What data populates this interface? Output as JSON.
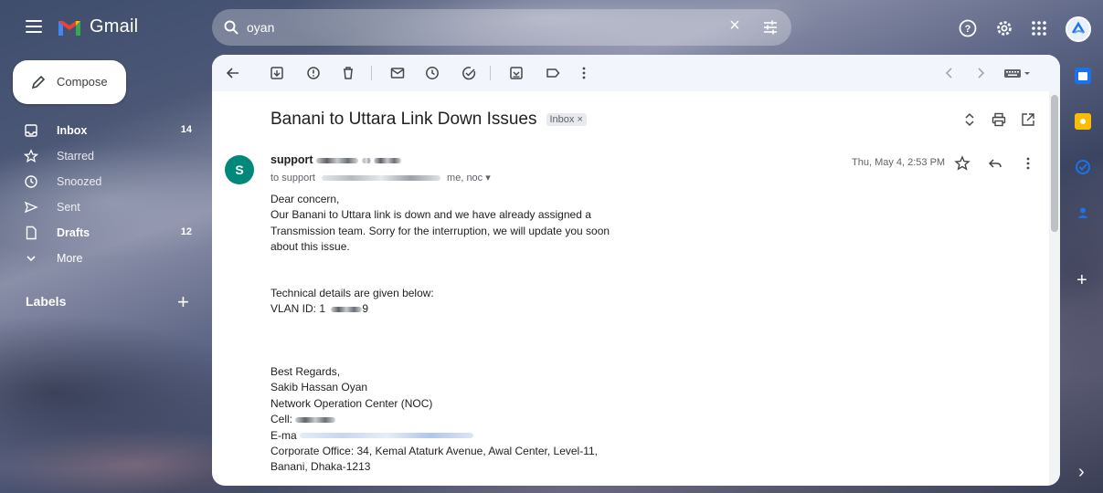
{
  "app": {
    "name": "Gmail"
  },
  "search": {
    "query": "oyan",
    "clear_label": "×"
  },
  "sidebar": {
    "compose_label": "Compose",
    "items": [
      {
        "label": "Inbox",
        "count": "14",
        "bold": true
      },
      {
        "label": "Starred",
        "count": ""
      },
      {
        "label": "Snoozed",
        "count": ""
      },
      {
        "label": "Sent",
        "count": ""
      },
      {
        "label": "Drafts",
        "count": "12",
        "bold": true
      },
      {
        "label": "More",
        "count": ""
      }
    ],
    "labels_heading": "Labels",
    "labels_add": "+"
  },
  "email": {
    "subject": "Banani to Uttara Link Down Issues",
    "tag": "Inbox ×",
    "sender_initial": "S",
    "sender_name": "support",
    "to_prefix": "to support",
    "to_suffix": "me, noc ▾",
    "date": "Thu, May 4, 2:53 PM",
    "body": {
      "greeting": "Dear concern,",
      "line1": "Our Banani to Uttara link is down and we have already assigned a",
      "line2": "Transmission team. Sorry for the interruption, we will update you soon",
      "line3": "about this issue.",
      "tech_heading": "Technical details are given below:",
      "vlan_prefix": "VLAN ID: 1",
      "vlan_suffix": "9",
      "regards": "Best Regards,",
      "sig_name": "Sakib Hassan Oyan",
      "sig_dept": "Network Operation Center (NOC)",
      "cell_label": "Cell:",
      "email_label": "E-ma",
      "office_line1": "Corporate Office: 34, Kemal Ataturk Avenue, Awal Center, Level-11,",
      "office_line2": "Banani, Dhaka-1213"
    }
  },
  "right_rail": {
    "add_label": "+",
    "expand_label": "›"
  },
  "colors": {
    "accent_blue": "#1a73e8",
    "avatar_teal": "#00897b",
    "gmail_red": "#ea4335"
  }
}
